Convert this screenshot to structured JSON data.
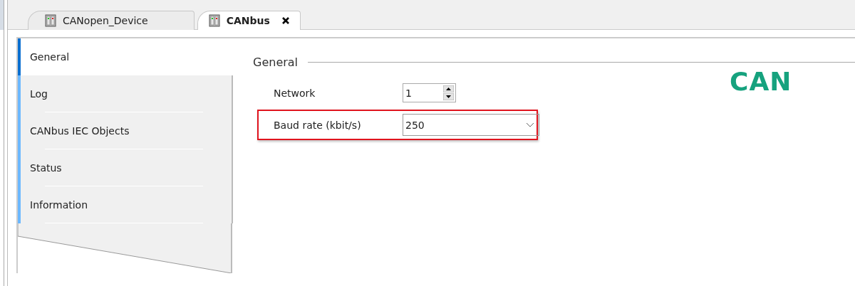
{
  "tabs": [
    {
      "label": "CANopen_Device",
      "selected": false,
      "closable": false
    },
    {
      "label": "CANbus",
      "selected": true,
      "closable": true
    }
  ],
  "sidebar": {
    "items": [
      {
        "label": "General",
        "selected": true
      },
      {
        "label": "Log",
        "selected": false
      },
      {
        "label": "CANbus IEC Objects",
        "selected": false
      },
      {
        "label": "Status",
        "selected": false
      },
      {
        "label": "Information",
        "selected": false
      }
    ]
  },
  "section": {
    "title": "General",
    "fields": [
      {
        "kind": "spinner",
        "label": "Network",
        "value": "1",
        "highlighted": false
      },
      {
        "kind": "dropdown",
        "label": "Baud rate (kbit/s)",
        "value": "250",
        "highlighted": true
      }
    ]
  },
  "logo": {
    "text": "CAN"
  }
}
